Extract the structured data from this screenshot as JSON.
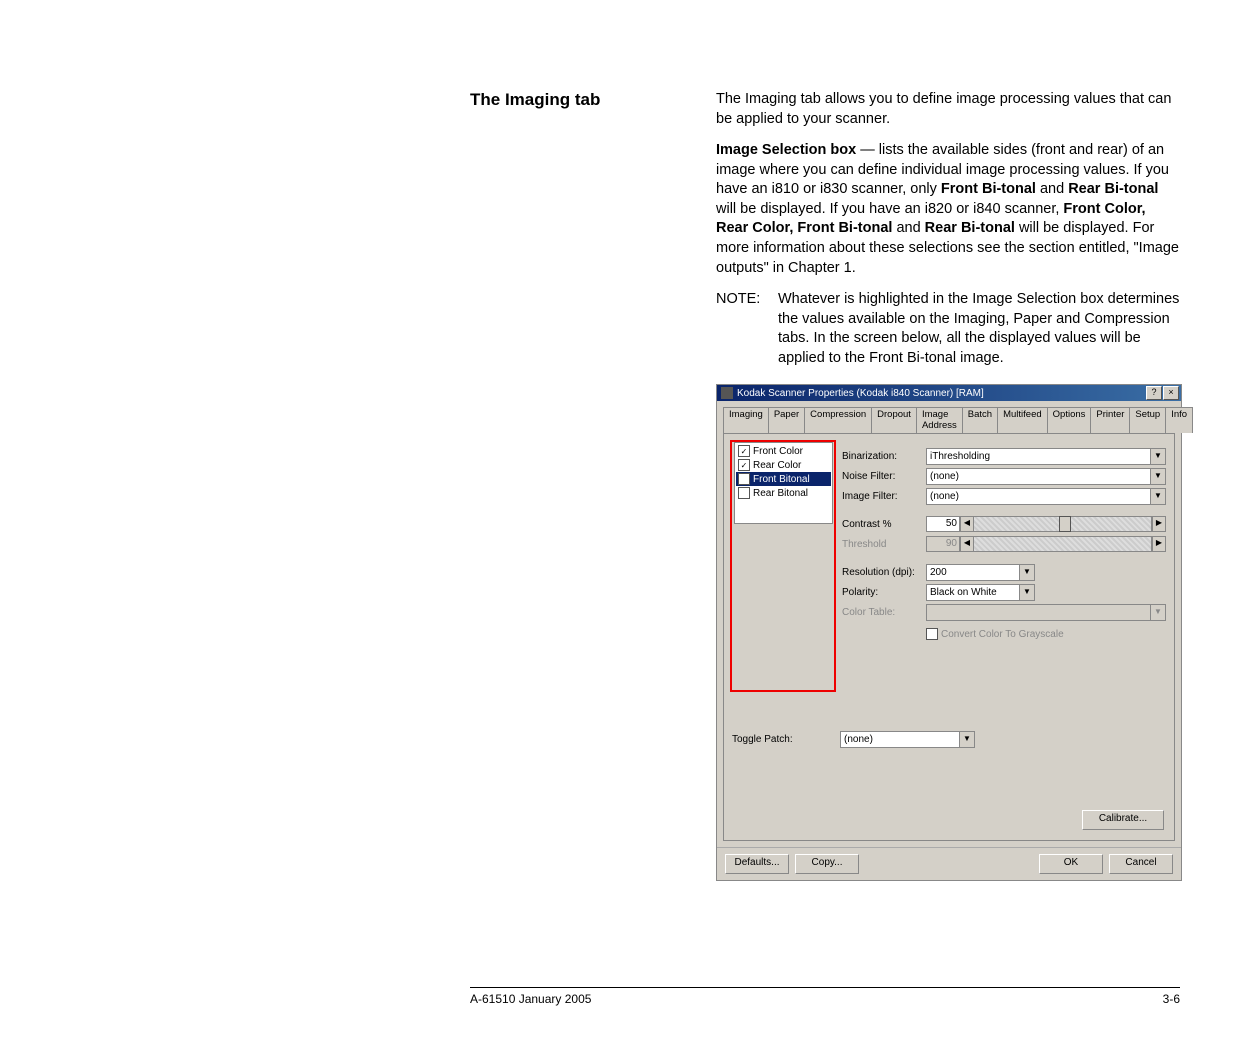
{
  "heading": "The Imaging tab",
  "p1": "The Imaging tab allows you to define image processing values that can be applied to your scanner.",
  "p2a": "Image Selection box",
  "p2b": " — lists the available sides (front and rear) of an image where you can define individual image processing values. If you have an i810 or i830 scanner, only ",
  "p2c": "Front Bi-tonal",
  "p2d": " and ",
  "p2e": "Rear Bi-tonal",
  "p2f": " will be displayed. If you have an i820 or i840 scanner, ",
  "p2g": "Front Color, Rear Color, Front Bi-tonal",
  "p2h": " and ",
  "p2i": "Rear Bi-tonal",
  "p2j": " will be displayed. For more information about these selections see the section entitled, \"Image outputs\" in Chapter 1.",
  "noteLabel": "NOTE:",
  "noteText": "Whatever is highlighted in the Image Selection box determines the values available on the Imaging, Paper and Compression tabs. In the screen below, all the displayed values will be applied to the Front Bi-tonal image.",
  "dialog": {
    "title": "Kodak Scanner Properties (Kodak i840 Scanner) [RAM]",
    "help": "?",
    "close": "×",
    "tabs": [
      "Imaging",
      "Paper",
      "Compression",
      "Dropout",
      "Image Address",
      "Batch",
      "Multifeed",
      "Options",
      "Printer",
      "Setup",
      "Info"
    ],
    "selection": {
      "items": [
        {
          "checked": true,
          "label": "Front Color",
          "selected": false
        },
        {
          "checked": true,
          "label": "Rear Color",
          "selected": false
        },
        {
          "checked": false,
          "label": "Front Bitonal",
          "selected": true
        },
        {
          "checked": false,
          "label": "Rear Bitonal",
          "selected": false
        }
      ]
    },
    "fields": {
      "binarization": {
        "label": "Binarization:",
        "value": "iThresholding"
      },
      "noiseFilter": {
        "label": "Noise Filter:",
        "value": "(none)"
      },
      "imageFilter": {
        "label": "Image Filter:",
        "value": "(none)"
      },
      "contrast": {
        "label": "Contrast %",
        "value": "50"
      },
      "threshold": {
        "label": "Threshold",
        "value": "90"
      },
      "resolution": {
        "label": "Resolution (dpi):",
        "value": "200"
      },
      "polarity": {
        "label": "Polarity:",
        "value": "Black on White"
      },
      "colorTable": {
        "label": "Color Table:",
        "value": ""
      },
      "convert": {
        "label": "Convert Color To Grayscale"
      }
    },
    "togglePatch": {
      "label": "Toggle Patch:",
      "value": "(none)"
    },
    "calibrate": "Calibrate...",
    "footer": {
      "defaults": "Defaults...",
      "copy": "Copy...",
      "ok": "OK",
      "cancel": "Cancel"
    }
  },
  "footer": {
    "left": "A-61510 January 2005",
    "right": "3-6"
  }
}
